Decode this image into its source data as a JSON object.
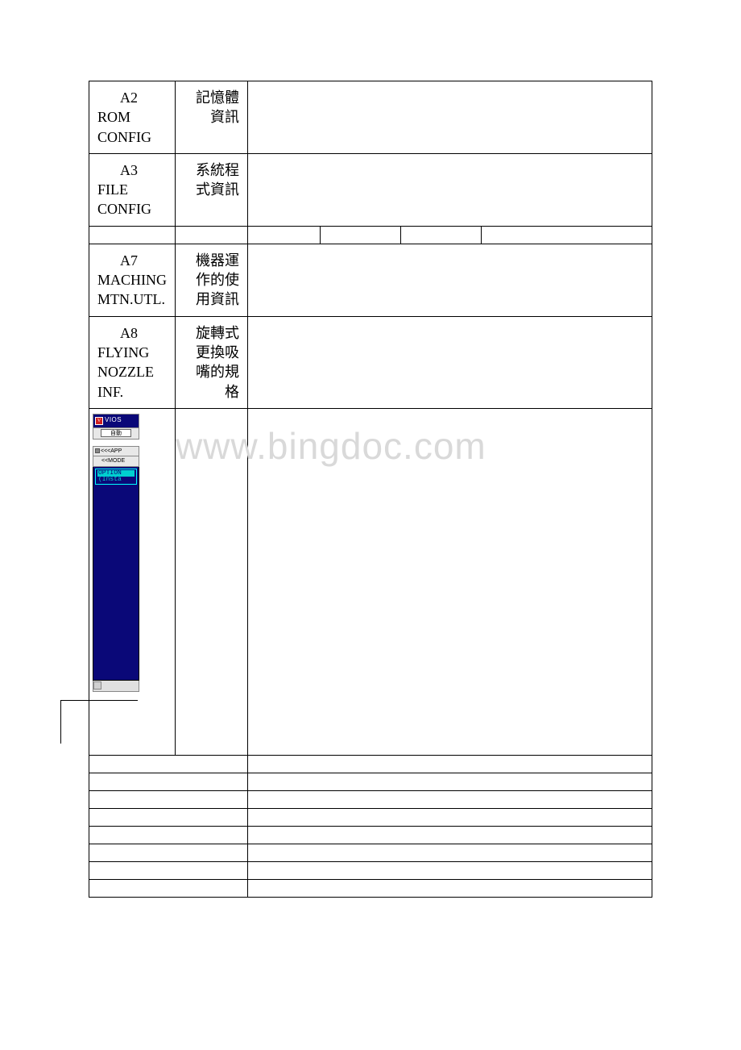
{
  "rows": {
    "a2": {
      "id": "A2",
      "code": "ROM CONFIG",
      "desc": "記憶體資訊"
    },
    "a3": {
      "id": "A3",
      "code": "FILE CONFIG",
      "desc": "系統程式資訊"
    },
    "a7": {
      "id": "A7",
      "code": "MACHING MTN.UTL.",
      "desc": "機器運作的使用資訊"
    },
    "a8": {
      "id": "A8",
      "code": "FLYING NOZZLE INF.",
      "desc": "旋轉式更換吸嘴的規格"
    }
  },
  "screenshot": {
    "title": "VIOS",
    "auto_button": "自動",
    "gray1": "<<<APP",
    "gray2": "<<MODE",
    "option_line1": "OPTION",
    "option_line2": "(Insta"
  },
  "watermark": "www.bingdoc.com"
}
